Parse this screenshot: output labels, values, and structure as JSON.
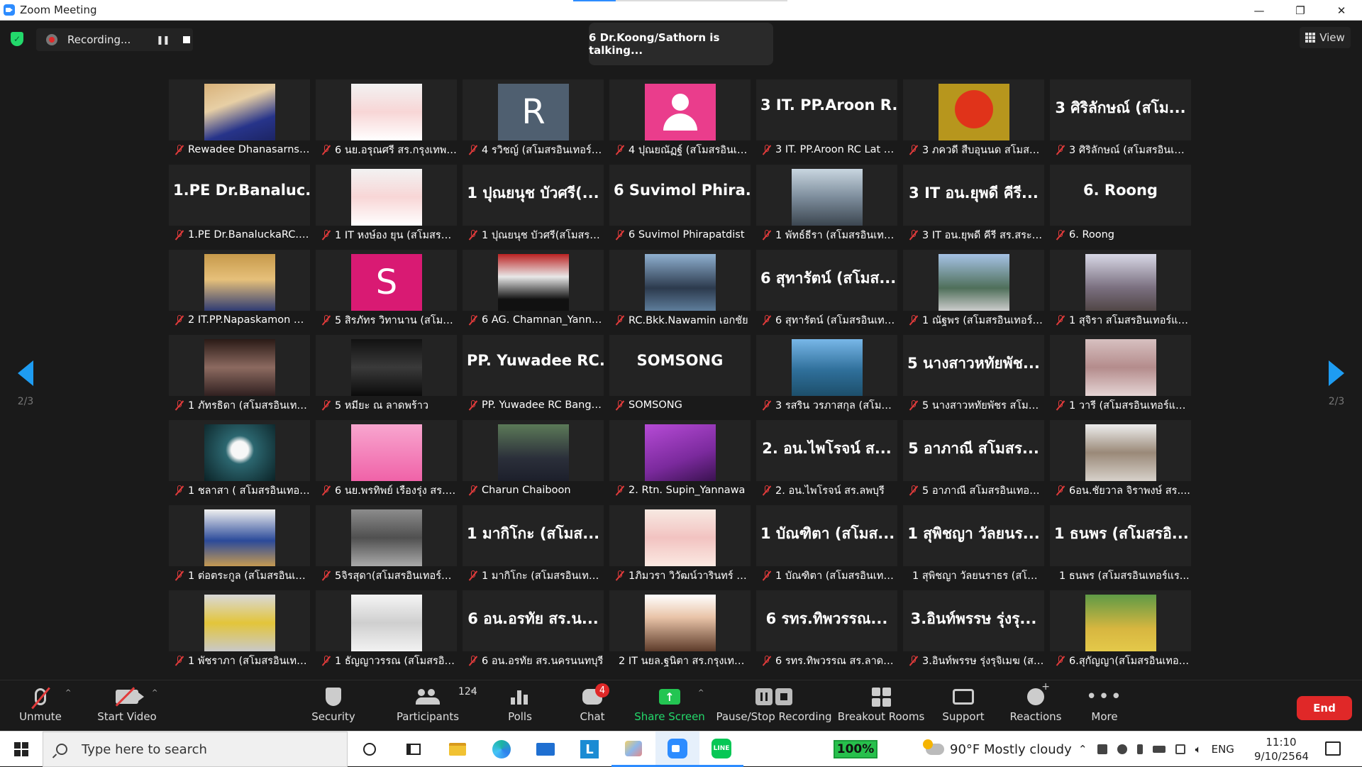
{
  "window": {
    "title": "Zoom Meeting",
    "minimize": "—",
    "restore": "❐",
    "close": "✕"
  },
  "meeting": {
    "recording_label": "Recording...",
    "pause_icon": "❚❚",
    "talking": "6 Dr.Koong/Sathorn is talking...",
    "view_label": "View",
    "page_left": "2/3",
    "page_right": "2/3"
  },
  "participants": [
    {
      "name": "Rewadee Dhanasarnsilp",
      "photo": "c-portrait"
    },
    {
      "name": "6 นย.อรุณศรี สร.กรุงเทพบ...",
      "photo": "c-white"
    },
    {
      "name": "4 รวิชญ์ (สโมสรอินเทอร์แ...",
      "letter": "R",
      "photo": "c-slate"
    },
    {
      "name": "4 ปุณยณัฏฐ์ (สโมสรอินเท...",
      "photo": "c-pink",
      "avatar": true
    },
    {
      "name": "3 IT. PP.Aroon RC Lat P...",
      "big": "3 IT. PP.Aroon R..."
    },
    {
      "name": "3 ภควดี สืบอุนนด สโมสร...",
      "photo": "c-elmo"
    },
    {
      "name": "3 ศิริลักษณ์ (สโมสรอินเทอ...",
      "big": "3 ศิริลักษณ์ (สโม..."
    },
    {
      "name": "1.PE Dr.BanaluckaRC.P...",
      "big": "1.PE Dr.Banaluc..."
    },
    {
      "name": "1 IT หงษ์อง ยุน (สโมสรอิน...",
      "photo": "c-white"
    },
    {
      "name": "1 ปุณยนุช บัวศรี(สโมสรอิ...",
      "big": "1 ปุณยนุช บัวศรี(..."
    },
    {
      "name": "6 Suvimol Phirapatdist",
      "big": "6 Suvimol Phira..."
    },
    {
      "name": "1 พัทธ์ธีรา (สโมสรอินเทอร์...",
      "photo": "c-street"
    },
    {
      "name": "3 IT อน.ยุพดี คีรี สร.สระป...",
      "big": "3 IT อน.ยุพดี คีรี..."
    },
    {
      "name": "6. Roong",
      "big": "6. Roong"
    },
    {
      "name": "2 IT.PP.Napaskamon B...",
      "photo": "c-office"
    },
    {
      "name": "5 สิรภัทร วิทานาน (สโมสร...",
      "letter": "S",
      "photo": "c-pinks"
    },
    {
      "name": "6 AG. Chamnan_Yanna...",
      "photo": "c-flag"
    },
    {
      "name": "RC.Bkk.Nawamin เอกชัย",
      "photo": "c-glasses"
    },
    {
      "name": "6 สุทารัตน์ (สโมสรอินเทอร์...",
      "big": "6 สุทารัตน์ (สโมส..."
    },
    {
      "name": "1 ณัฐพร (สโมสรอินเทอร์แ...",
      "photo": "c-outdoor"
    },
    {
      "name": "1 สุจิรา สโมสรอินเทอร์แรค...",
      "photo": "c-road"
    },
    {
      "name": "1 ภัทรธิดา (สโมสรอินเทอร์...",
      "photo": "c-dark"
    },
    {
      "name": "5 หมียะ ณ ลาดพร้าว",
      "photo": "c-bw"
    },
    {
      "name": "PP. Yuwadee RC Bang ...",
      "big": "PP. Yuwadee RC..."
    },
    {
      "name": "SOMSONG",
      "big": "SOMSONG"
    },
    {
      "name": "3 รสริน วรภาสกุล (สโมส...",
      "photo": "c-sea"
    },
    {
      "name": "5 นางสาวหทัยพัชร สโมสร...",
      "big": "5 นางสาวหทัยพัช..."
    },
    {
      "name": "1 วารี (สโมสรอินเทอร์แรค...",
      "photo": "c-soft"
    },
    {
      "name": "1 ชลาสา ( สโมสรอินเทอร์...",
      "photo": "c-teal"
    },
    {
      "name": "6  นย.พรทิพย์ เรืองรุ่ง สร. ...",
      "photo": "c-pinkbg"
    },
    {
      "name": "Charun Chaiboon",
      "photo": "c-suit"
    },
    {
      "name": "2. Rtn. Supin_Yannawa",
      "photo": "c-purple"
    },
    {
      "name": "2. อน.ไพโรจน์ สร.ลพบุรี",
      "big": "2. อน.ไพโรจน์ ส..."
    },
    {
      "name": "5 อาภาณี สโมสรอินเทอร์แ...",
      "big": "5 อาภาณี สโมสร..."
    },
    {
      "name": "6อน.ชัยวาล จิราพงษ์  สร....",
      "photo": "c-cafe"
    },
    {
      "name": "1 ต่อตระกูล (สโมสรอินเตอ...",
      "photo": "c-guitar"
    },
    {
      "name": "5จิรสุดา(สโมสรอินเทอร์แร...",
      "photo": "c-garden"
    },
    {
      "name": "1 มากิโกะ (สโมสรอินเทอร์...",
      "big": "1 มากิโกะ (สโมส..."
    },
    {
      "name": "1ภิมวรา วิวัฒน์วารินทร์ (ส...",
      "photo": "c-frame"
    },
    {
      "name": "1 บัณฑิตา (สโมสรอินเทอร์...",
      "big": "1 บัณฑิตา (สโมส..."
    },
    {
      "name": "1 สุพิชญา วัลยนราธร (สโมสร...",
      "big": "1 สุพิชญา วัลยนร...",
      "muted": false
    },
    {
      "name": "1 ธนพร (สโมสรอินเทอร์แร...",
      "big": "1 ธนพร (สโมสรอิ...",
      "muted": false
    },
    {
      "name": "1 พัชราภา (สโมสรอินเทอร์...",
      "photo": "c-yellow"
    },
    {
      "name": "1 ธัญญาวรรณ (สโมสรอิน...",
      "photo": "c-sketch"
    },
    {
      "name": "6 อน.อรทัย  สร.นครนนทบุรี",
      "big": "6 อน.อรทัย  สร.น..."
    },
    {
      "name": "2 IT นยล.ฐนิตา สร.กรุงเทพ น...",
      "photo": "c-woman",
      "muted": false
    },
    {
      "name": "6 รทร.ทิพวรรณ สร.ลาดพ...",
      "big": "6 รทร.ทิพวรรณ..."
    },
    {
      "name": "3.อินท์พรรษ รุ่งรุจิเมฆ (สโ...",
      "big": "3.อินท์พรรษ รุ่งรุ..."
    },
    {
      "name": "6.สุกัญญา(สโมสรอินเทอร์...",
      "photo": "c-greenbg"
    }
  ],
  "toolbar": {
    "unmute": "Unmute",
    "start_video": "Start Video",
    "security": "Security",
    "participants": "Participants",
    "participants_count": "124",
    "polls": "Polls",
    "chat": "Chat",
    "chat_badge": "4",
    "share_screen": "Share Screen",
    "pause_stop": "Pause/Stop Recording",
    "breakout": "Breakout Rooms",
    "support": "Support",
    "reactions": "Reactions",
    "more": "More",
    "end": "End",
    "caret": "^"
  },
  "taskbar": {
    "search_placeholder": "Type here to search",
    "battery": "100%",
    "weather": "90°F  Mostly cloudy",
    "lang": "ENG",
    "time": "11:10",
    "date": "9/10/2564",
    "l_app": "L",
    "line_app": "LINE"
  },
  "colors": {
    "accent": "#2d8cff",
    "end": "#e02828",
    "share": "#23c552",
    "mute": "#e23b3b"
  }
}
